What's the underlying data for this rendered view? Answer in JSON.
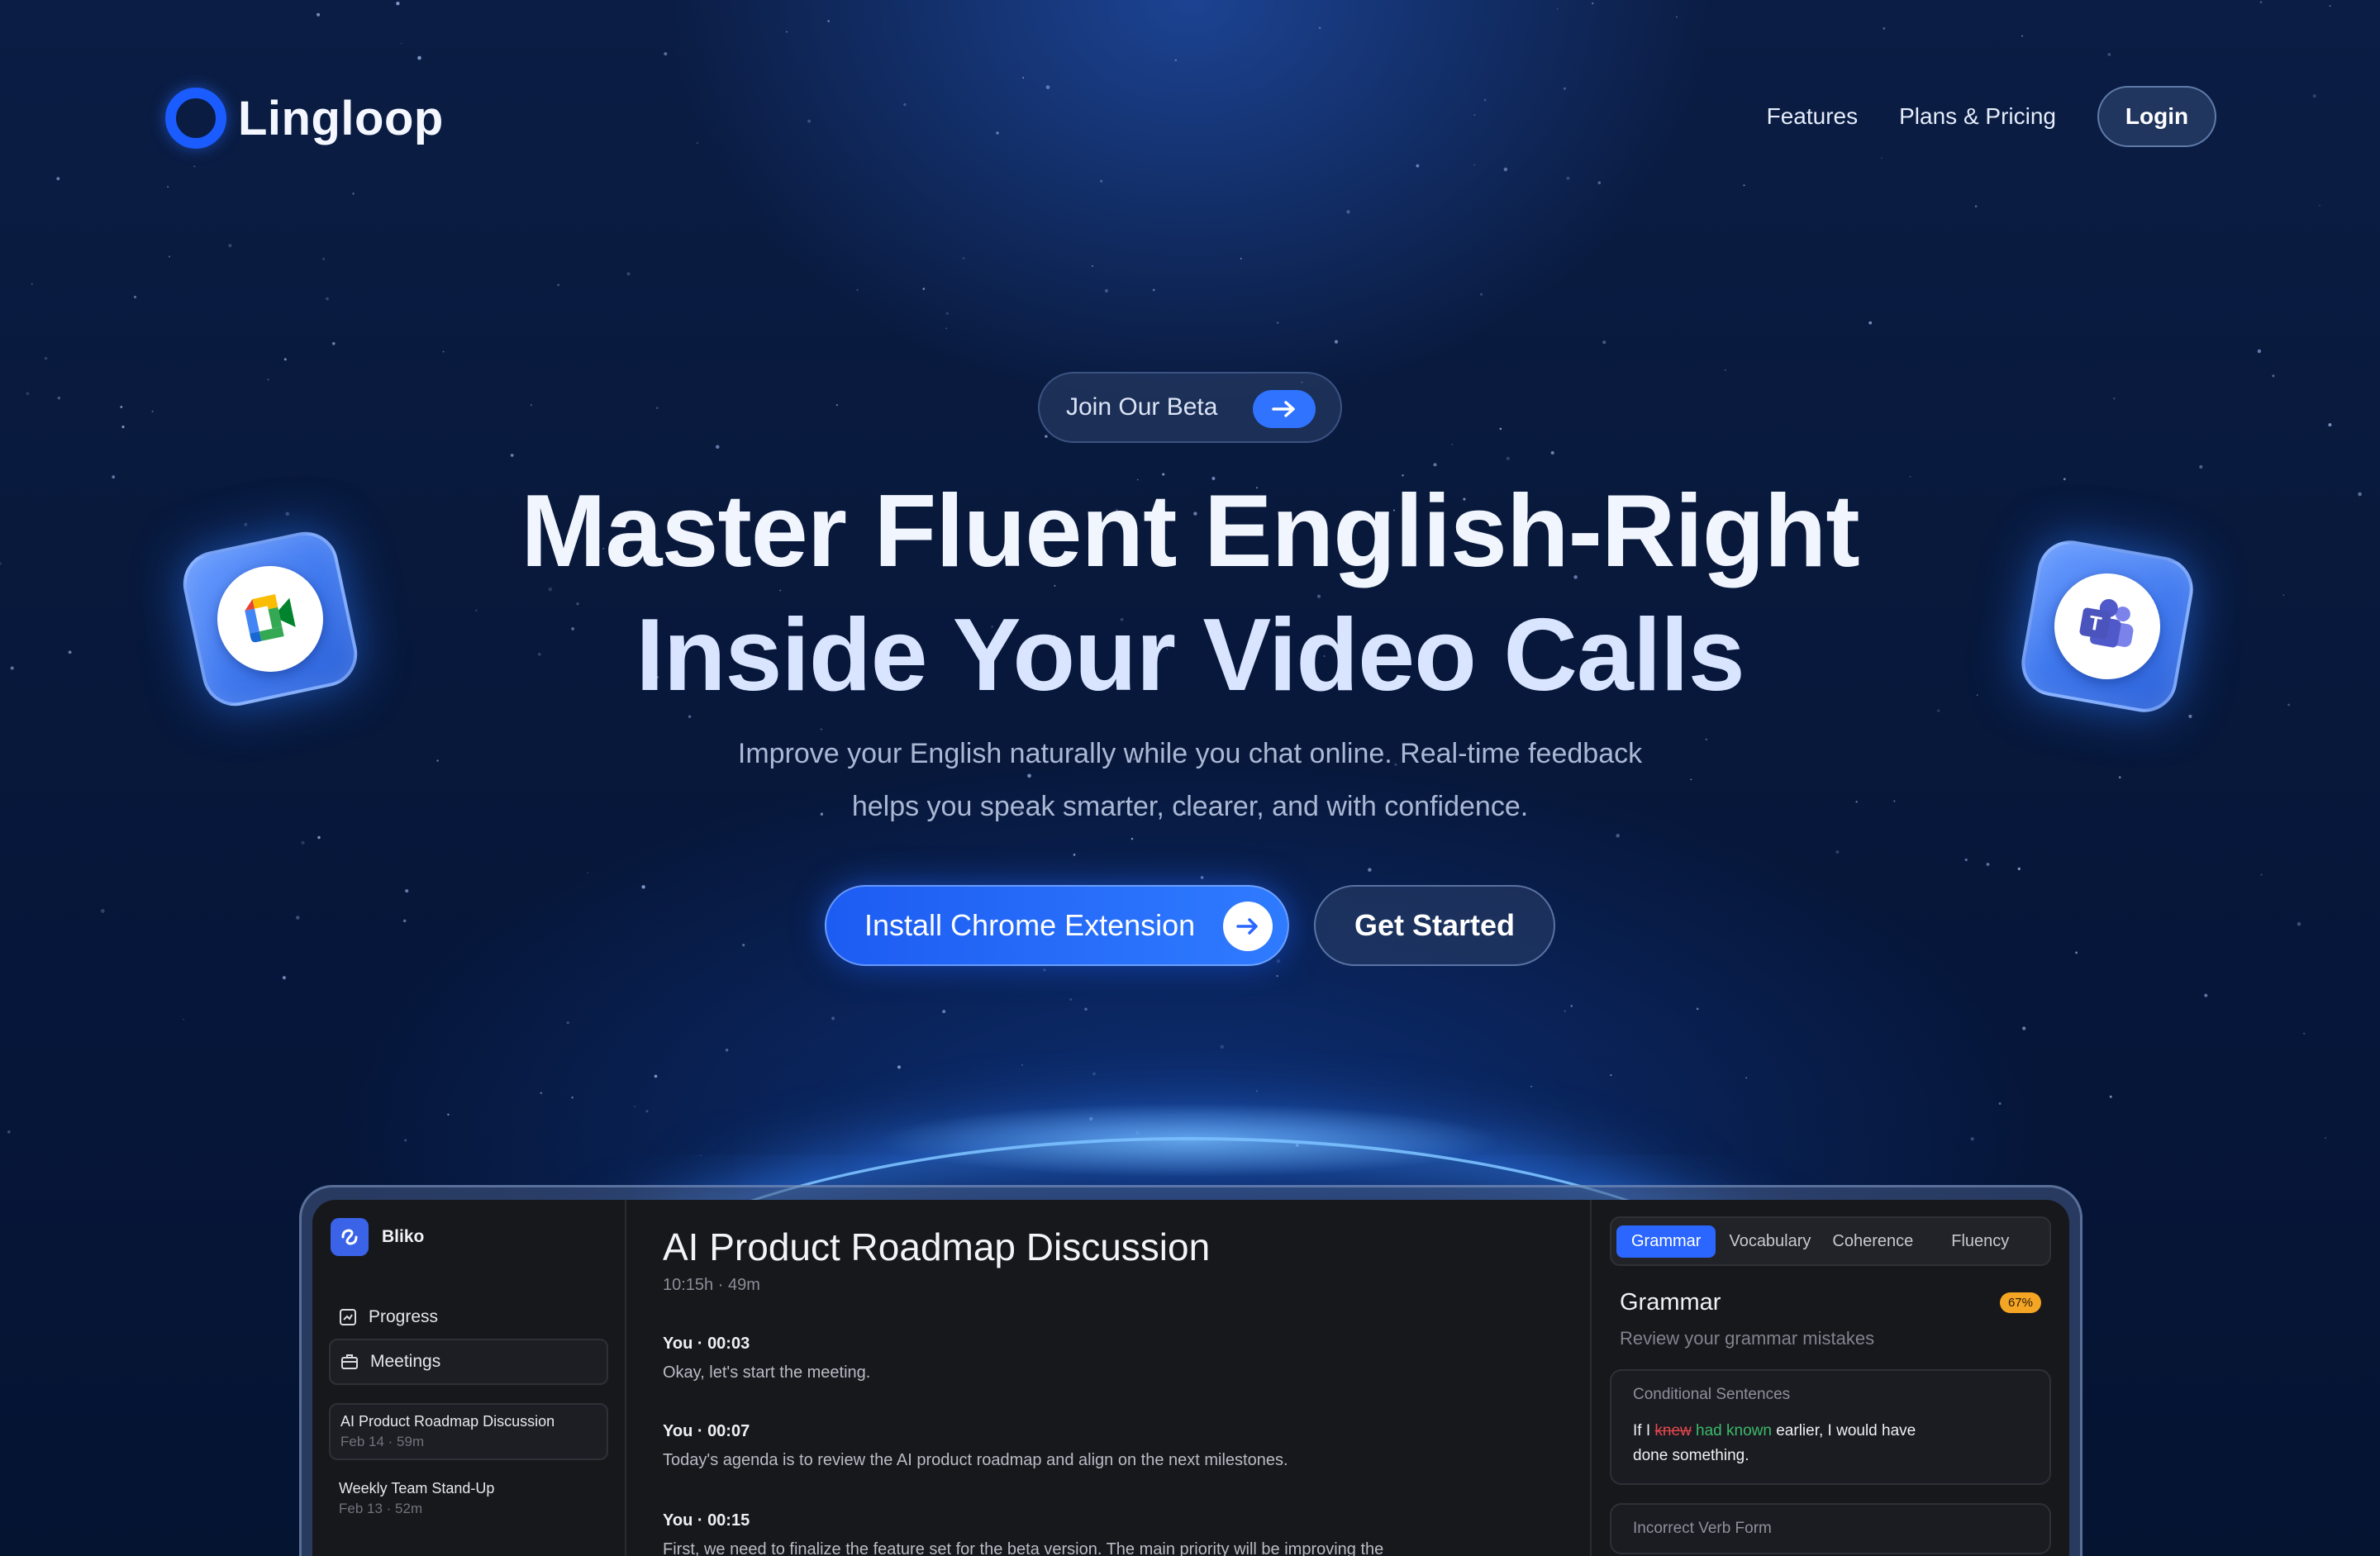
{
  "brand": {
    "name": "Lingloop"
  },
  "nav": {
    "links": [
      "Features",
      "Plans & Pricing"
    ],
    "login_label": "Login"
  },
  "hero": {
    "beta_label": "Join Our Beta",
    "headline_line1": "Master Fluent English-Right",
    "headline_line2": "Inside Your Video Calls",
    "subtitle_line1": "Improve your English naturally while you chat online. Real-time feedback",
    "subtitle_line2": "helps you speak smarter, clearer, and with confidence.",
    "cta_primary": "Install Chrome Extension",
    "cta_secondary": "Get Started"
  },
  "tiles": {
    "left": "google-meet-icon",
    "right": "microsoft-teams-icon"
  },
  "app": {
    "brand_name": "Bliko",
    "sidebar": {
      "progress_label": "Progress",
      "meetings_label": "Meetings",
      "meetings": [
        {
          "title": "AI Product Roadmap Discussion",
          "meta": "Feb 14 · 59m"
        },
        {
          "title": "Weekly Team Stand-Up",
          "meta": "Feb 13 · 52m"
        }
      ]
    },
    "transcript": {
      "title": "AI Product Roadmap Discussion",
      "meta": "10:15h · 49m",
      "lines": [
        {
          "speaker": "You · 00:03",
          "text": "Okay, let's start the meeting."
        },
        {
          "speaker": "You · 00:07",
          "text": "Today's agenda is to review the AI product roadmap and align on the next milestones."
        },
        {
          "speaker": "You · 00:15",
          "text": "First, we need to finalize the feature set for the beta version. The main priority will be improving the"
        }
      ]
    },
    "panel": {
      "tabs": [
        "Grammar",
        "Vocabulary",
        "Coherence",
        "Fluency"
      ],
      "active_tab": "Grammar",
      "title": "Grammar",
      "badge": "67%",
      "subtitle": "Review your grammar mistakes",
      "cards": [
        {
          "label": "Conditional Sentences",
          "prefix": "If I ",
          "wrong": "knew",
          "correct": "had known",
          "suffix": " earlier, I would have",
          "line2": "done something."
        },
        {
          "label": "Incorrect Verb Form"
        }
      ]
    }
  },
  "colors": {
    "accent": "#2a66ff",
    "background": "#07183a",
    "badge": "#f5a524",
    "error": "#e5484d",
    "correct": "#3cba6a"
  }
}
